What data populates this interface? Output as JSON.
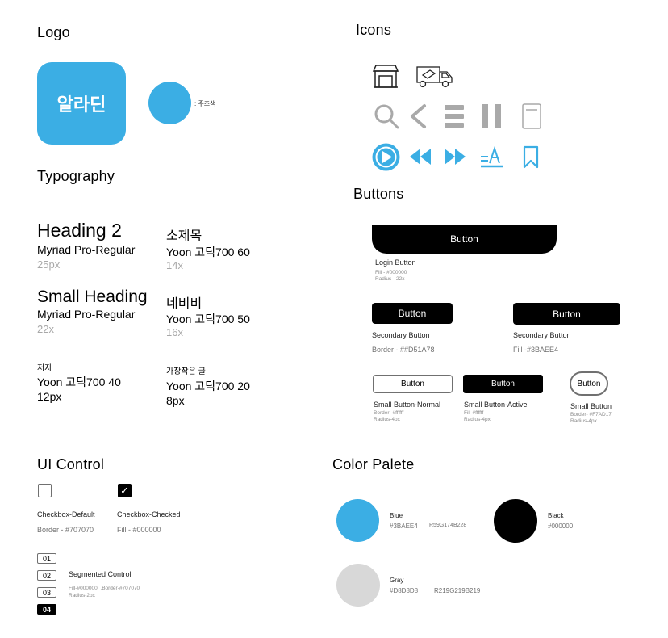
{
  "logo": {
    "section_title": "Logo",
    "brand_text": "알라딘",
    "dot_label": ": 주조색",
    "brand_color": "#3BAEE4"
  },
  "typography": {
    "section_title": "Typography",
    "styles": [
      {
        "title": "Heading 2",
        "font": "Myriad Pro-Regular",
        "size": "25px"
      },
      {
        "title": "Small Heading",
        "font": "Myriad Pro-Regular",
        "size": "22x"
      },
      {
        "title": "저자",
        "font": "Yoon 고딕700 40",
        "size": "12px"
      },
      {
        "title": "소제목",
        "font": "Yoon 고딕700 60",
        "size": "14x"
      },
      {
        "title": "네비비",
        "font": "Yoon 고딕700 50",
        "size": "16x"
      },
      {
        "title": "가장작은 글",
        "font": "Yoon 고딕700 20",
        "size": "8px"
      }
    ]
  },
  "icons": {
    "section_title": "Icons",
    "row1": [
      "store-icon",
      "delivery-truck-icon"
    ],
    "row2": [
      "search-icon",
      "back-chevron-icon",
      "menu-icon",
      "pause-icon",
      "document-icon"
    ],
    "row3": [
      "play-icon",
      "rewind-icon",
      "fast-forward-icon",
      "text-size-icon",
      "bookmark-icon"
    ],
    "gray_color": "#a9a9a9",
    "blue_color": "#3BAEE4"
  },
  "buttons": {
    "section_title": "Buttons",
    "login": {
      "label": "Button",
      "caption": "Login Button",
      "fill": "Fill - #000000",
      "radius": "Radius - 22x"
    },
    "secondary_1": {
      "label": "Button",
      "caption": "Secondary Button",
      "spec": "Border - ##D51A78"
    },
    "secondary_2": {
      "label": "Button",
      "caption": "Secondary Button",
      "spec": "Fill -#3BAEE4"
    },
    "small_normal": {
      "label": "Button",
      "caption": "Small Button-Normal",
      "border": "Border- #ffffff",
      "radius": "Radius-4px"
    },
    "small_active": {
      "label": "Button",
      "caption": "Small Button-Active",
      "fill": "Fill-#ffffff",
      "radius": "Radius-4px"
    },
    "small_round": {
      "label": "Button",
      "caption": "Small Button",
      "border": "Border- #F7AD17",
      "radius": "Radius-4px"
    }
  },
  "ui_control": {
    "section_title": "UI Control",
    "checkbox_default": {
      "caption": "Checkbox-Default",
      "spec": "Border - #707070"
    },
    "checkbox_checked": {
      "caption": "Checkbox-Checked",
      "spec": "Fill - #000000",
      "check_mark": "✓"
    },
    "segments": [
      "01",
      "02",
      "03",
      "04"
    ],
    "segmented_caption": "Segmented Control",
    "segmented_spec": "Fill-#000000  ,Border-#707070",
    "segmented_radius": "Radius-2px"
  },
  "color_palette": {
    "section_title": "Color Palete",
    "colors": [
      {
        "name": "Blue",
        "hex": "#3BAEE4",
        "rgb": "R59G174B228",
        "swatch": "#3BAEE4"
      },
      {
        "name": "Black",
        "hex": "#000000",
        "rgb": "",
        "swatch": "#000000"
      },
      {
        "name": "Gray",
        "hex": "#D8D8D8",
        "rgb": "R219G219B219",
        "swatch": "#D8D8D8"
      }
    ]
  }
}
